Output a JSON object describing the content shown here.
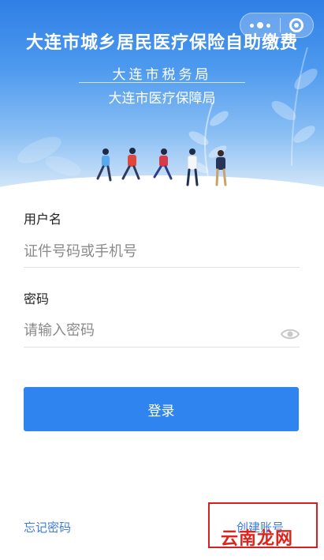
{
  "header": {
    "title": "大连市城乡居民医疗保险自助缴费",
    "subtitle_1": "大连市税务局",
    "subtitle_2": "大连市医疗保障局"
  },
  "form": {
    "username_label": "用户名",
    "username_placeholder": "证件号码或手机号",
    "password_label": "密码",
    "password_placeholder": "请输入密码",
    "login_label": "登录"
  },
  "footer": {
    "forgot_password": "忘记密码",
    "create_account": "创建账号"
  },
  "watermark": "云南龙网",
  "colors": {
    "primary": "#2f84f0",
    "link": "#3d7cd8",
    "highlight": "#d62020"
  }
}
